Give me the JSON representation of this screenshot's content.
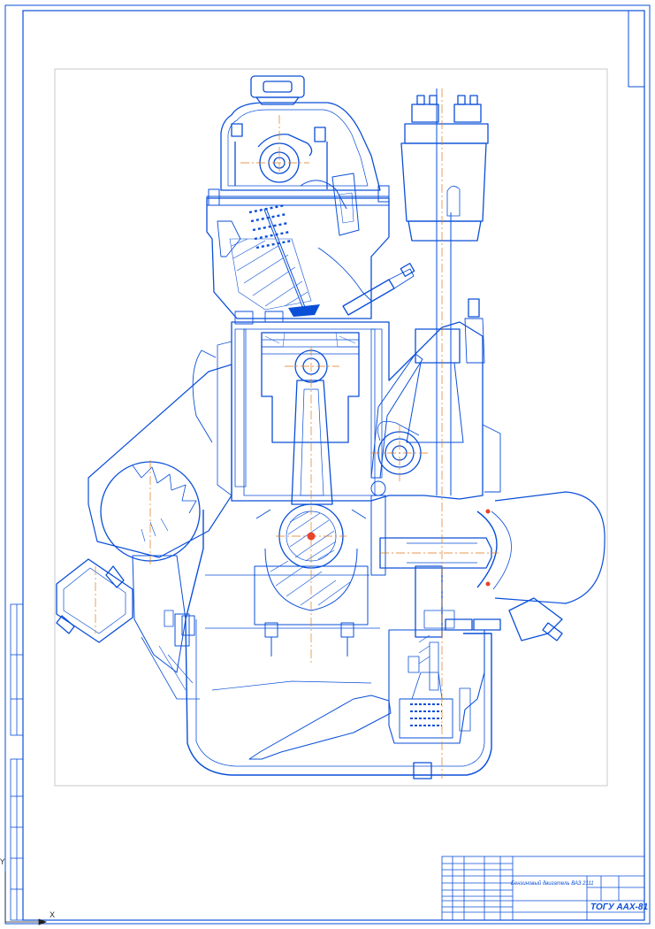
{
  "title_block": {
    "drawing_title": "Бензиновый двигатель ВАЗ 2111",
    "designation": "ТОГУ ААХ-81"
  },
  "axis_marks": {
    "y": "Y",
    "x": "X"
  },
  "colors": {
    "line": "#0a4fd8",
    "center_line": "#e07a1a",
    "paper_frame": "#c8c8c8",
    "detail": "#e8442b"
  }
}
